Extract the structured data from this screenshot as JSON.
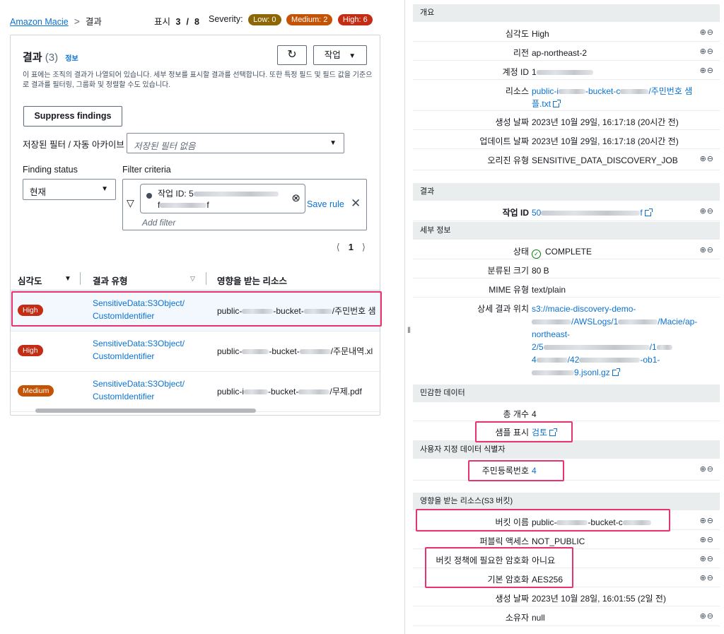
{
  "header": {
    "breadcrumb_root": "Amazon Macie",
    "breadcrumb_current": "결과",
    "showing_label": "표시",
    "showing_current": "3",
    "showing_sep": "/",
    "showing_total": "8",
    "severity_label": "Severity:",
    "low_badge": "Low: 0",
    "medium_badge": "Medium: 2",
    "high_badge": "High: 6"
  },
  "panel": {
    "title": "결과",
    "count": "(3)",
    "info_link": "정보",
    "refresh_icon": "refresh-icon",
    "actions_label": "작업",
    "description": "이 표에는 조직의 결과가 나열되어 있습니다. 세부 정보를 표시할 결과를 선택합니다. 또한 특정 필드 및 필드 값을 기준으로 결과를 필터링, 그룹화 및 정렬할 수도 있습니다.",
    "suppress_label": "Suppress findings",
    "saved_filter_label": "저장된 필터 / 자동 아카이브",
    "saved_filter_placeholder": "저장된 필터 없음",
    "status_label": "Finding status",
    "status_value": "현재",
    "criteria_label": "Filter criteria",
    "token_key": "작업 ID",
    "token_value_start": "5",
    "token_value_line2_start": "f",
    "token_value_line2_end": "f",
    "save_rule": "Save rule",
    "add_filter": "Add filter",
    "page": "1"
  },
  "table": {
    "columns": [
      "심각도",
      "결과 유형",
      "영향을 받는 리소스"
    ],
    "rows": [
      {
        "severity": "High",
        "type_l1": "SensitiveData:S3Object/",
        "type_l2": "CustomIdentifier",
        "res_a": "public-",
        "res_b": "-bucket-",
        "res_c": "/주민번호 샘"
      },
      {
        "severity": "High",
        "type_l1": "SensitiveData:S3Object/",
        "type_l2": "CustomIdentifier",
        "res_a": "public-",
        "res_b": "-bucket-",
        "res_c": "/주문내역.xl"
      },
      {
        "severity": "Medium",
        "type_l1": "SensitiveData:S3Object/",
        "type_l2": "CustomIdentifier",
        "res_a": "public-i",
        "res_b": "-bucket-",
        "res_c": "/무제.pdf"
      }
    ]
  },
  "details": {
    "overview": {
      "title": "개요",
      "severity_k": "심각도",
      "severity_v": "High",
      "region_k": "리전",
      "region_v": "ap-northeast-2",
      "account_k": "계정 ID",
      "account_v": "1",
      "resource_k": "리소스",
      "resource_a": "public-i",
      "resource_b": "-bucket-c",
      "resource_c": "/주민번호 샘",
      "resource_d": "플.txt",
      "created_k": "생성 날짜",
      "created_v": "2023년 10월 29일, 16:17:18 (20시간 전)",
      "updated_k": "업데이트 날짜",
      "updated_v": "2023년 10월 29일, 16:17:18 (20시간 전)",
      "origin_k": "오리진 유형",
      "origin_v": "SENSITIVE_DATA_DISCOVERY_JOB"
    },
    "result": {
      "title": "결과",
      "job_k": "작업 ID",
      "job_a": "50",
      "job_b": "f"
    },
    "info": {
      "title": "세부 정보",
      "status_k": "상태",
      "status_v": "COMPLETE",
      "size_k": "분류된 크기",
      "size_v": "80 B",
      "mime_k": "MIME 유형",
      "mime_v": "text/plain",
      "loc_k": "상세 결과 위치",
      "loc_l1": "s3://macie-discovery-demo-",
      "loc_l2_b": "/AWSLogs/1",
      "loc_l2_d": "/Macie/ap-",
      "loc_l3": "northeast-",
      "loc_l4_a": "2/5",
      "loc_l4_c": "/1",
      "loc_l5_a": "4",
      "loc_l5_c": "/42",
      "loc_l5_e": "-ob1-",
      "loc_l6_b": "9.jsonl.gz"
    },
    "sensitive": {
      "title": "민감한 데이터",
      "total_k": "총 개수",
      "total_v": "4",
      "sample_k": "샘플 표시",
      "sample_v": "검토"
    },
    "custom": {
      "title": "사용자 지정 데이터 식별자",
      "rrn_k": "주민등록번호",
      "rrn_v": "4"
    },
    "bucket": {
      "title": "영향을 받는 리소스(S3 버킷)",
      "name_k": "버킷 이름",
      "name_a": "public-",
      "name_b": "-bucket-c",
      "public_k": "퍼블릭 액세스",
      "public_v": "NOT_PUBLIC",
      "enc_req_k": "버킷 정책에 필요한 암호화",
      "enc_req_v": "아니요",
      "enc_def_k": "기본 암호화",
      "enc_def_v": "AES256",
      "created_k": "생성 날짜",
      "created_v": "2023년 10월 28일, 16:01:55 (2일 전)",
      "owner_k": "소유자",
      "owner_v": "null"
    },
    "zoom_in_icon": "zoom-in-icon",
    "zoom_out_icon": "zoom-out-icon"
  },
  "colors": {
    "link": "#0972d3",
    "high": "#c42c14",
    "medium": "#c55305",
    "low": "#8d6605",
    "highlight": "#e8336e"
  }
}
